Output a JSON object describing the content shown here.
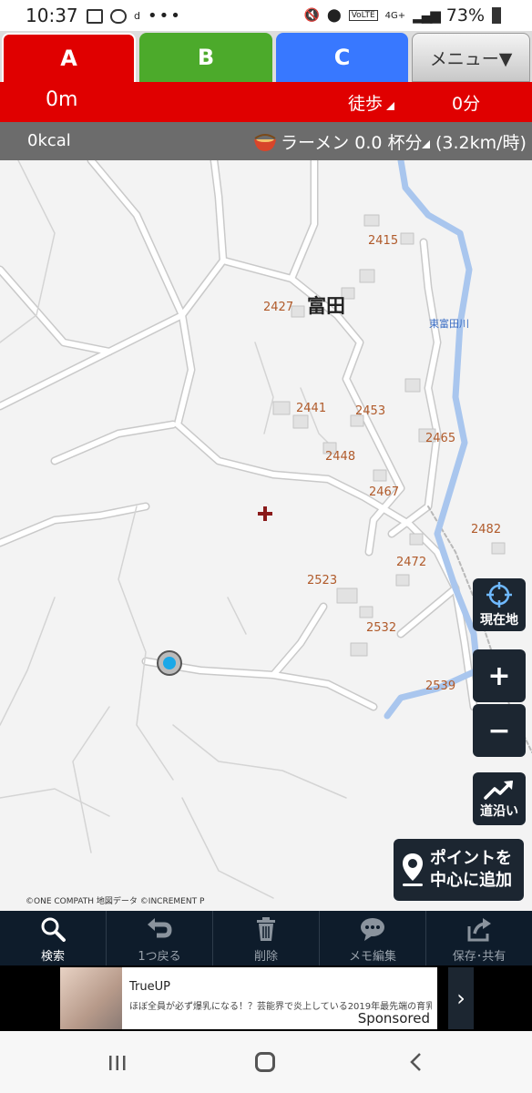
{
  "status_bar": {
    "time": "10:37",
    "network": "4G+",
    "volte": "VoLTE",
    "battery": "73%"
  },
  "tabs": [
    {
      "label": "A",
      "color": "#e00000",
      "active": true
    },
    {
      "label": "B",
      "color": "#4caa2b",
      "active": false
    },
    {
      "label": "C",
      "color": "#3878ff",
      "active": false
    }
  ],
  "menu_label": "メニュー▼",
  "route_info": {
    "distance": "0m",
    "mode": "徒歩",
    "duration": "0分"
  },
  "calorie_info": {
    "kcal": "0kcal",
    "food": "ラーメン 0.0 杯分",
    "speed": "(3.2km/時)"
  },
  "map": {
    "place_name": "富田",
    "river_name": "東富田川",
    "address_numbers": [
      "2415",
      "2427",
      "2441",
      "2453",
      "2465",
      "2448",
      "2467",
      "2482",
      "2472",
      "2523",
      "2532",
      "2539"
    ],
    "credit": "©ONE COMPATH 地図データ ©INCREMENT P"
  },
  "map_controls": {
    "current_location": "現在地",
    "zoom_in": "+",
    "zoom_out": "−",
    "along_road": "道沿い",
    "add_point_line1": "ポイントを",
    "add_point_line2": "中心に追加"
  },
  "toolbar": [
    {
      "label": "検索",
      "icon": "search-icon",
      "enabled": true
    },
    {
      "label": "1つ戻る",
      "icon": "undo-icon",
      "enabled": false
    },
    {
      "label": "削除",
      "icon": "trash-icon",
      "enabled": false
    },
    {
      "label": "メモ編集",
      "icon": "memo-icon",
      "enabled": false
    },
    {
      "label": "保存･共有",
      "icon": "share-icon",
      "enabled": false
    }
  ],
  "ad": {
    "title": "TrueUP",
    "description": "ほぼ全員が必ず爆乳になる！？芸能界で炎上している2019年最先端の育乳…",
    "sponsored": "Sponsored",
    "arrow": "›"
  }
}
